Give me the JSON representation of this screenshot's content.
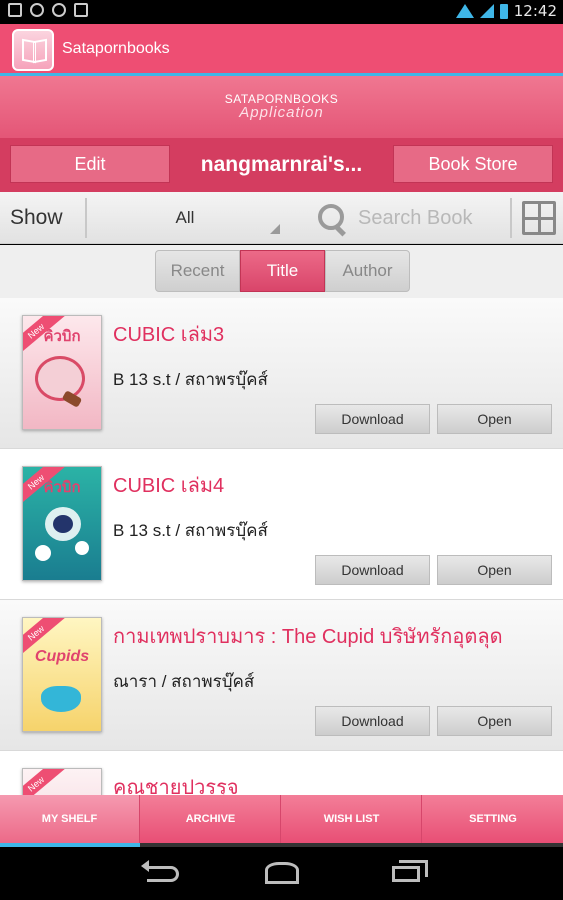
{
  "status_bar": {
    "time": "12:42",
    "left_icons": [
      "image-icon",
      "cloud-icon",
      "sync-icon",
      "bag-icon"
    ],
    "right_icons": [
      "wifi-icon",
      "signal-icon",
      "battery-icon"
    ]
  },
  "app": {
    "title": "Satapornbooks",
    "logo_icon": "book-icon",
    "accent": "#ee4e73",
    "highlight": "#3fb6e7"
  },
  "banner": {
    "title": "SATAPORNBOOKS",
    "subtitle": "Application"
  },
  "nav": {
    "edit_label": "Edit",
    "shelf_owner": "nangmarnrai's...",
    "store_label": "Book Store"
  },
  "filter": {
    "show_label": "Show",
    "show_value": "All",
    "search_placeholder": "Search Book",
    "grid_icon": "grid-view-icon"
  },
  "sort": {
    "tabs": [
      "Recent",
      "Title",
      "Author"
    ],
    "active": "Title"
  },
  "books": [
    {
      "title": "CUBIC เล่ม3",
      "author": "B 13 s.t / สถาพรบุ๊คส์",
      "badge": "New",
      "cover_title": "คิวบิก",
      "download_label": "Download",
      "open_label": "Open"
    },
    {
      "title": "CUBIC เล่ม4",
      "author": "B 13 s.t / สถาพรบุ๊คส์",
      "badge": "New",
      "cover_title": "คิวบิก",
      "download_label": "Download",
      "open_label": "Open"
    },
    {
      "title": "กามเทพปราบมาร : The Cupid บริษัทรักอุตลุด",
      "author": "ณารา / สถาพรบุ๊คส์",
      "badge": "New",
      "cover_title": "Cupids",
      "download_label": "Download",
      "open_label": "Open"
    },
    {
      "title": "คุณชายปวรรุจ",
      "author": "",
      "badge": "New",
      "cover_title": "",
      "download_label": "",
      "open_label": ""
    }
  ],
  "bottom_tabs": [
    "MY SHELF",
    "ARCHIVE",
    "WISH LIST",
    "SETTING"
  ],
  "bottom_tab_active": "MY SHELF",
  "system_nav": [
    "back-icon",
    "home-icon",
    "recents-icon"
  ]
}
